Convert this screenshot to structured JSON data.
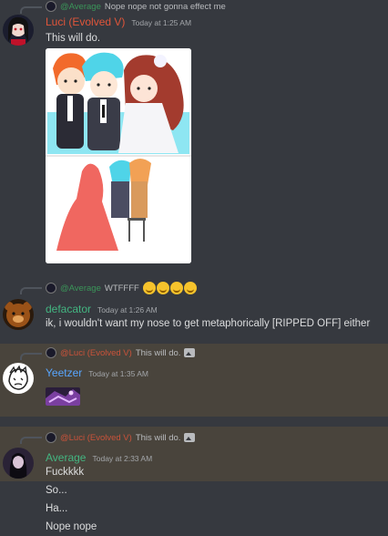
{
  "messages": [
    {
      "reply_user": "@Average",
      "reply_text": "Nope nope not gonna effect me",
      "username": "Luci (Evolved V)",
      "username_color": "#e0553a",
      "timestamp": "Today at 1:25 AM",
      "lines": [
        "This will do."
      ],
      "attachment": "image",
      "avatar_icon": "dark-hair-avatar-icon"
    },
    {
      "reply_user": "@Average",
      "reply_text": "WTFFFF",
      "reply_emoji_count": 4,
      "username": "defacator",
      "username_color": "#43b581",
      "timestamp": "Today at 1:26 AM",
      "lines": [
        "ik, i wouldn't want my nose to get metaphorically [RIPPED OFF] either"
      ],
      "avatar_icon": "bear-avatar-icon"
    },
    {
      "reply_user": "@Luci (Evolved V)",
      "reply_text": "This will do.",
      "username": "Yeetzer",
      "username_color": "#58a6ff",
      "timestamp": "Today at 1:35 AM",
      "lines": [],
      "attachment": "small-image",
      "avatar_icon": "sketch-face-avatar-icon",
      "highlighted": true
    },
    {
      "reply_user": "@Luci (Evolved V)",
      "reply_text": "This will do.",
      "username": "Average",
      "username_color": "#43b581",
      "timestamp": "Today at 2:33 AM",
      "lines": [
        "Fuckkkk",
        "So...",
        "Ha...",
        "Nope nope"
      ],
      "avatar_icon": "dark-figure-avatar-icon",
      "highlighted": true
    }
  ],
  "colors": {
    "background": "#36393f",
    "highlight": "#49443c",
    "reply_user_color": "#3ba55d"
  }
}
